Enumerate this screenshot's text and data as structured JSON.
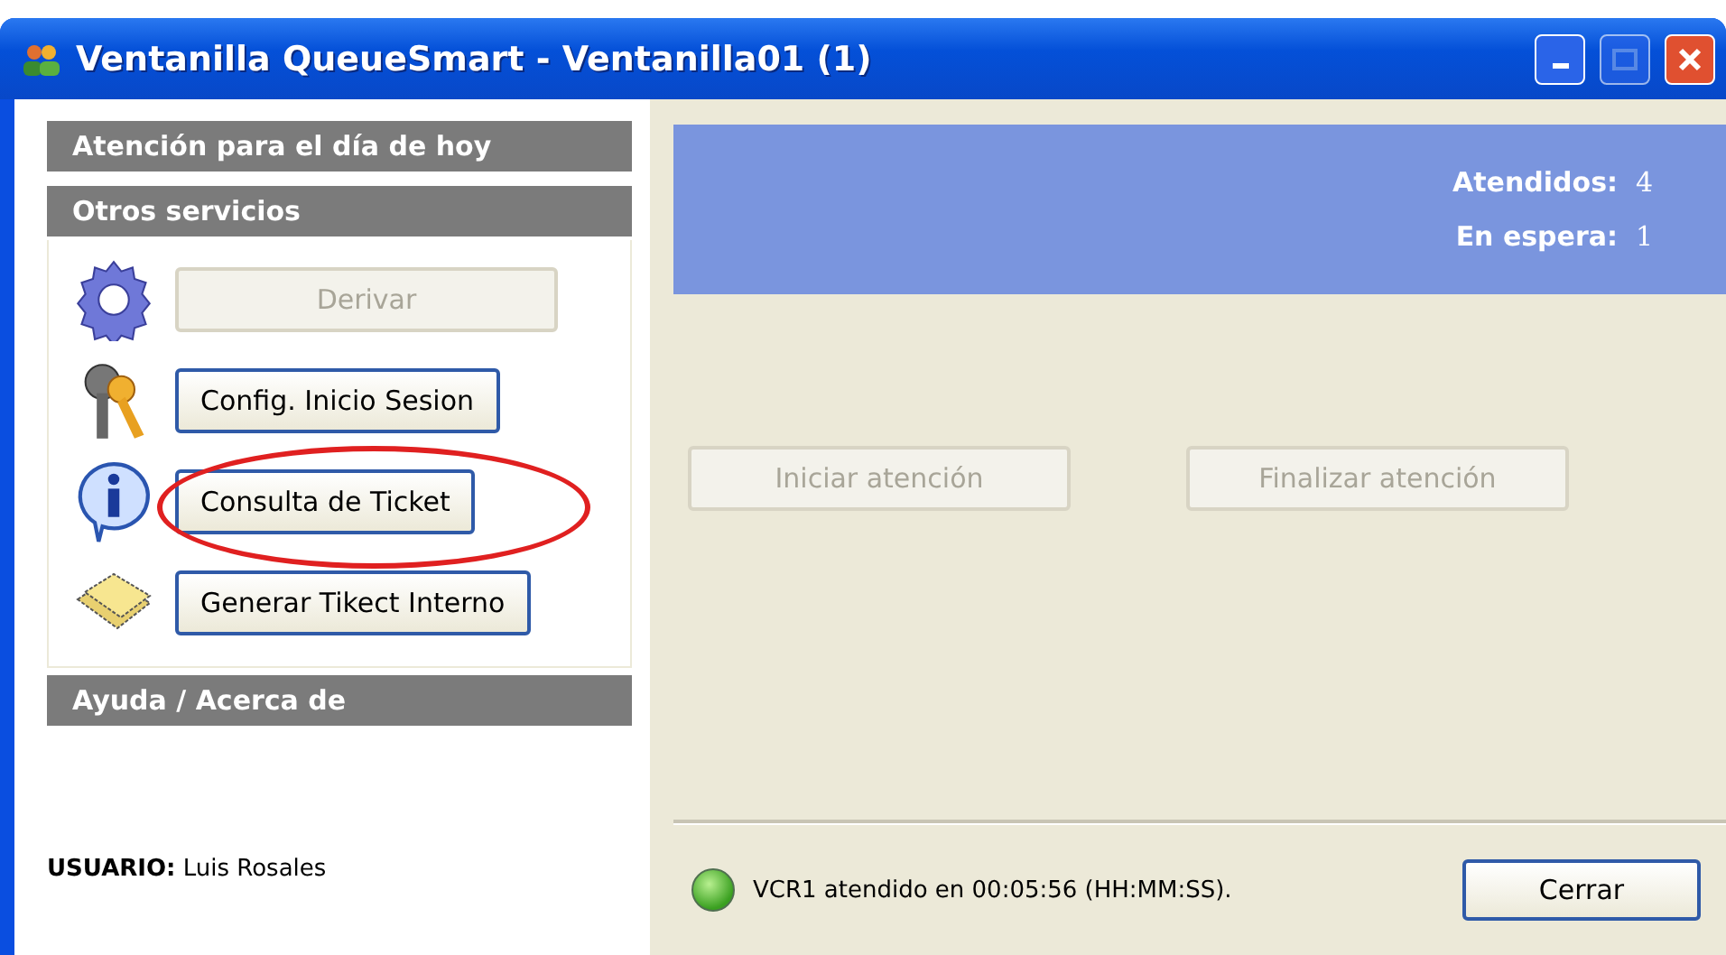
{
  "window": {
    "title": "Ventanilla QueueSmart - Ventanilla01 (1)"
  },
  "sidebar": {
    "sections": [
      {
        "title": "Atención para el día de hoy"
      },
      {
        "title": "Otros servicios",
        "items": [
          {
            "label": "Derivar",
            "disabled": true,
            "highlighted": false
          },
          {
            "label": "Config. Inicio Sesion",
            "disabled": false,
            "highlighted": false
          },
          {
            "label": "Consulta de Ticket",
            "disabled": false,
            "highlighted": true
          },
          {
            "label": "Generar Tikect Interno",
            "disabled": false,
            "highlighted": false
          }
        ]
      },
      {
        "title": "Ayuda / Acerca de"
      }
    ],
    "user_label": "USUARIO:",
    "user_name": "Luis Rosales"
  },
  "stats": [
    {
      "label": "Atendidos:",
      "value": "4"
    },
    {
      "label": "En espera:",
      "value": "1"
    }
  ],
  "actions": [
    {
      "label": "Iniciar atención",
      "disabled": true
    },
    {
      "label": "Finalizar atención",
      "disabled": true
    }
  ],
  "status_bar": {
    "message": "VCR1 atendido en 00:05:56 (HH:MM:SS).",
    "button": "Cerrar"
  }
}
